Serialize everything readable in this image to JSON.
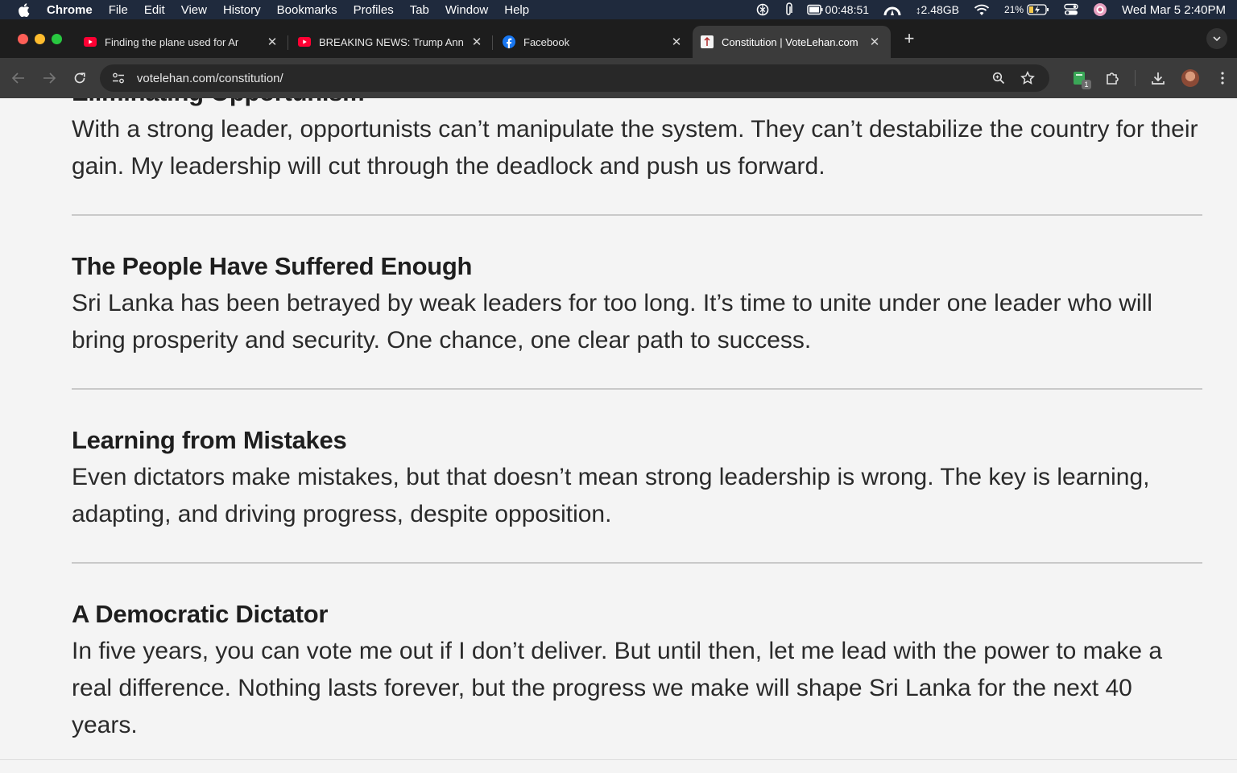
{
  "menubar": {
    "app": "Chrome",
    "menus": [
      "File",
      "Edit",
      "View",
      "History",
      "Bookmarks",
      "Profiles",
      "Tab",
      "Window",
      "Help"
    ],
    "timer": "00:48:51",
    "memory": "2.48GB",
    "battery": "21%",
    "datetime": "Wed Mar 5  2:40PM"
  },
  "tabs": [
    {
      "title": "Finding the plane used for Ar",
      "favicon": "youtube-icon"
    },
    {
      "title": "BREAKING NEWS: Trump Ann",
      "favicon": "youtube-icon"
    },
    {
      "title": "Facebook",
      "favicon": "facebook-icon"
    },
    {
      "title": "Constitution | VoteLehan.com",
      "favicon": "site-icon"
    }
  ],
  "toolbar": {
    "url": "votelehan.com/constitution/",
    "extension_badge": "1"
  },
  "content": {
    "sections": [
      {
        "heading": "Eliminating Opportunism",
        "body": "With a strong leader, opportunists can’t manipulate the system. They can’t destabilize the country for their gain. My leadership will cut through the deadlock and push us forward."
      },
      {
        "heading": "The People Have Suffered Enough",
        "body": "Sri Lanka has been betrayed by weak leaders for too long. It’s time to unite under one leader who will bring prosperity and security. One chance, one clear path to success."
      },
      {
        "heading": "Learning from Mistakes",
        "body": "Even dictators make mistakes, but that doesn’t mean strong leadership is wrong. The key is learning, adapting, and driving progress, despite opposition."
      },
      {
        "heading": "A Democratic Dictator",
        "body": "In five years, you can vote me out if I don’t deliver. But until then, let me lead with the power to make a real difference. Nothing lasts forever, but the progress we make will shape Sri Lanka for the next 40 years."
      }
    ]
  }
}
